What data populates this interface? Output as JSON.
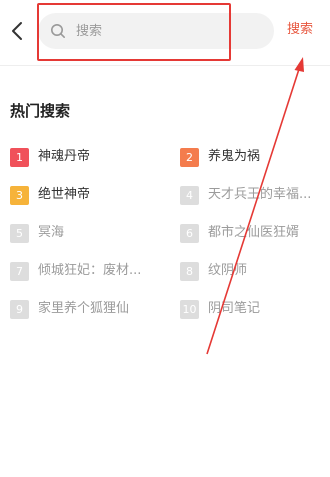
{
  "header": {
    "search_placeholder": "搜索",
    "search_button_label": "搜索"
  },
  "hot_search": {
    "title": "热门搜索",
    "items": [
      {
        "rank": "1",
        "term": "神魂丹帝",
        "badge_color": "#f0515a",
        "text_style": "dark"
      },
      {
        "rank": "2",
        "term": "养鬼为祸",
        "badge_color": "#f47c4d",
        "text_style": "dark"
      },
      {
        "rank": "3",
        "term": "绝世神帝",
        "badge_color": "#f6b33a",
        "text_style": "dark"
      },
      {
        "rank": "4",
        "term": "天才兵王的幸福...",
        "badge_color": "#dddddd",
        "text_style": "light"
      },
      {
        "rank": "5",
        "term": "冥海",
        "badge_color": "#dddddd",
        "text_style": "light"
      },
      {
        "rank": "6",
        "term": "都市之仙医狂婿",
        "badge_color": "#dddddd",
        "text_style": "light"
      },
      {
        "rank": "7",
        "term": "倾城狂妃：废材...",
        "badge_color": "#dddddd",
        "text_style": "light"
      },
      {
        "rank": "8",
        "term": "纹阴师",
        "badge_color": "#dddddd",
        "text_style": "light"
      },
      {
        "rank": "9",
        "term": "家里养个狐狸仙",
        "badge_color": "#dddddd",
        "text_style": "light"
      },
      {
        "rank": "10",
        "term": "阴司笔记",
        "badge_color": "#dddddd",
        "text_style": "light"
      }
    ]
  },
  "colors": {
    "accent": "#e8573f",
    "highlight_border": "#e53935",
    "arrow": "#e53935"
  },
  "icons": {
    "back": "chevron-left-icon",
    "search": "search-icon"
  }
}
